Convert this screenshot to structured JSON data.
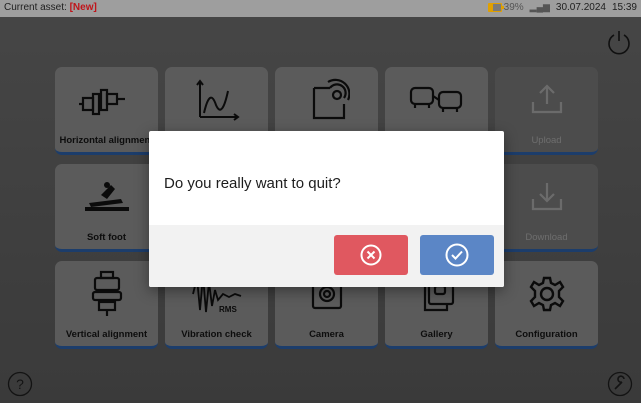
{
  "status_bar": {
    "asset_prefix": "Current asset:",
    "asset_name": "[New]",
    "battery_percent": "39%",
    "battery_level": 0.39,
    "date": "30.07.2024",
    "time": "15:39"
  },
  "tiles": [
    {
      "label": "Horizontal alignment",
      "icon": "horizontal-alignment-icon",
      "enabled": true
    },
    {
      "label": "",
      "icon": "curve-chart-icon",
      "enabled": true
    },
    {
      "label": "",
      "icon": "sensor-icon",
      "enabled": true
    },
    {
      "label": "",
      "icon": "machines-icon",
      "enabled": true
    },
    {
      "label": "Upload",
      "icon": "upload-icon",
      "enabled": false
    },
    {
      "label": "Soft foot",
      "icon": "soft-foot-icon",
      "enabled": true
    },
    {
      "label": "Download",
      "icon": "download-icon",
      "enabled": false
    },
    {
      "label": "Vertical alignment",
      "icon": "vertical-alignment-icon",
      "enabled": true
    },
    {
      "label": "Vibration check",
      "icon": "vibration-icon",
      "enabled": true
    },
    {
      "label": "Camera",
      "icon": "camera-icon",
      "enabled": true
    },
    {
      "label": "Gallery",
      "icon": "gallery-icon",
      "enabled": true
    },
    {
      "label": "Configuration",
      "icon": "gear-icon",
      "enabled": true
    }
  ],
  "vibration_icon_text": "RMS",
  "dialog": {
    "message": "Do you really want to quit?",
    "cancel_icon": "cancel-icon",
    "confirm_icon": "confirm-icon"
  },
  "colors": {
    "cancel": "#e05860",
    "confirm": "#5b86c6",
    "tile_accent": "#2b5fa5",
    "asset_new": "#c0141a"
  }
}
